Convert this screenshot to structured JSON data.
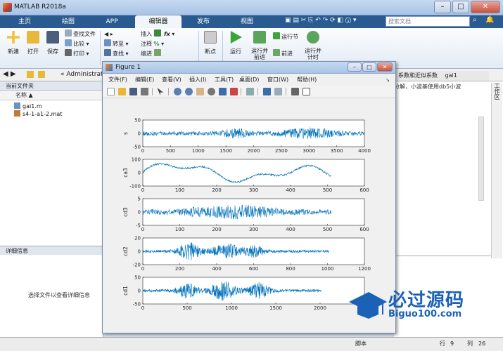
{
  "window": {
    "title": "MATLAB R2018a"
  },
  "tabs": [
    "主页",
    "绘图",
    "APP",
    "编辑器",
    "发布",
    "视图"
  ],
  "search": {
    "placeholder": "搜索文档"
  },
  "ribbon": {
    "new": "新建",
    "open": "打开",
    "save": "保存",
    "find_files": "查找文件",
    "compare": "比较",
    "print": "打印",
    "insert": "插入",
    "comment": "注释",
    "indent": "缩进",
    "goto": "转至",
    "find": "查找",
    "breakpoints": "断点",
    "run": "运行",
    "run_advance": "运行并\n前进",
    "run_section": "运行节",
    "advance": "前进",
    "run_time": "运行并\n计时",
    "section_file": "文件"
  },
  "address": {
    "path": "« Administrat"
  },
  "current_folder": {
    "header": "当前文件夹",
    "name_col": "名称 ▲",
    "files": [
      "gai1.m",
      "s4-1-a1-2.mat"
    ]
  },
  "details": {
    "header": "详细信息",
    "empty_text": "选择文件以查看详细信息"
  },
  "editor_right": {
    "tab1": "系数和近似系数",
    "tab2": "gai1",
    "snippet": "分解，小波基使用db5小波"
  },
  "status": {
    "script": "脚本",
    "row_label": "行",
    "row": "9",
    "col_label": "列",
    "col": "26"
  },
  "figure": {
    "title": "Figure 1",
    "menus": [
      "文件(F)",
      "编辑(E)",
      "查看(V)",
      "插入(I)",
      "工具(T)",
      "桌面(D)",
      "窗口(W)",
      "帮助(H)"
    ]
  },
  "watermark": {
    "main": "必过源码",
    "sub": "Biguo100.com"
  },
  "chart_data": [
    {
      "type": "line",
      "ylabel": "s",
      "x_ticks": [
        0,
        500,
        1000,
        1500,
        2000,
        2500,
        3000,
        3500,
        4000
      ],
      "y_ticks": [
        -50,
        0,
        50
      ],
      "xlim": [
        0,
        4000
      ],
      "ylim": [
        -50,
        50
      ],
      "n": 4000
    },
    {
      "type": "line",
      "ylabel": "ca3",
      "x_ticks": [
        0,
        100,
        200,
        300,
        400,
        500,
        600
      ],
      "y_ticks": [
        -100,
        0,
        100
      ],
      "xlim": [
        0,
        600
      ],
      "ylim": [
        -100,
        100
      ],
      "n": 510
    },
    {
      "type": "line",
      "ylabel": "cd3",
      "x_ticks": [
        0,
        100,
        200,
        300,
        400,
        500,
        600
      ],
      "y_ticks": [
        -5,
        0,
        5
      ],
      "xlim": [
        0,
        600
      ],
      "ylim": [
        -5,
        5
      ],
      "n": 510
    },
    {
      "type": "line",
      "ylabel": "cd2",
      "x_ticks": [
        0,
        200,
        400,
        600,
        800,
        1000,
        1200
      ],
      "y_ticks": [
        -20,
        0,
        20
      ],
      "xlim": [
        0,
        1200
      ],
      "ylim": [
        -20,
        20
      ],
      "n": 1010
    },
    {
      "type": "line",
      "ylabel": "cd1",
      "x_ticks": [
        0,
        500,
        1000,
        1500,
        2000,
        2500
      ],
      "y_ticks": [
        -50,
        0,
        50
      ],
      "xlim": [
        0,
        2500
      ],
      "ylim": [
        -50,
        50
      ],
      "n": 2010
    }
  ]
}
